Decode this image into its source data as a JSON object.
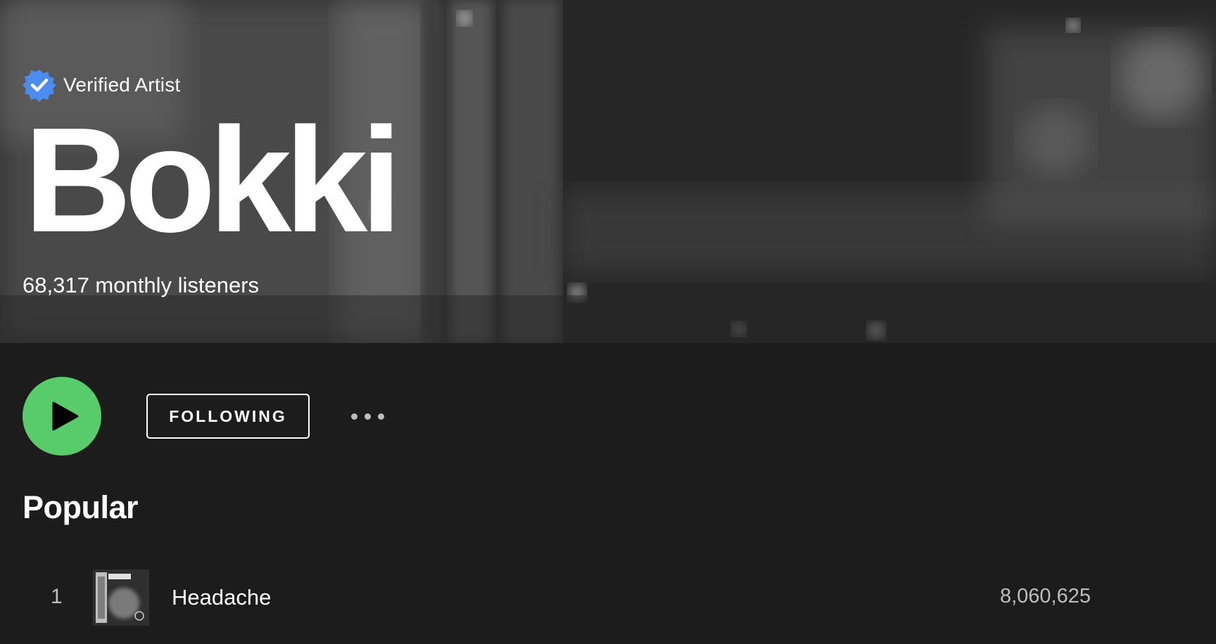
{
  "hero": {
    "verified_label": "Verified Artist",
    "artist_name": "Bokki",
    "monthly_listeners": "68,317 monthly listeners"
  },
  "actions": {
    "follow_label": "FOLLOWING",
    "play_icon": "play-icon",
    "more_icon": "more-horizontal-icon"
  },
  "popular": {
    "title": "Popular",
    "tracks": [
      {
        "index": "1",
        "title": "Headache",
        "plays": "8,060,625"
      }
    ]
  },
  "colors": {
    "background": "#1c1c1c",
    "play_button": "#58cb6a",
    "verified_badge": "#4a8cf0",
    "secondary_text": "#bdbdbd"
  }
}
